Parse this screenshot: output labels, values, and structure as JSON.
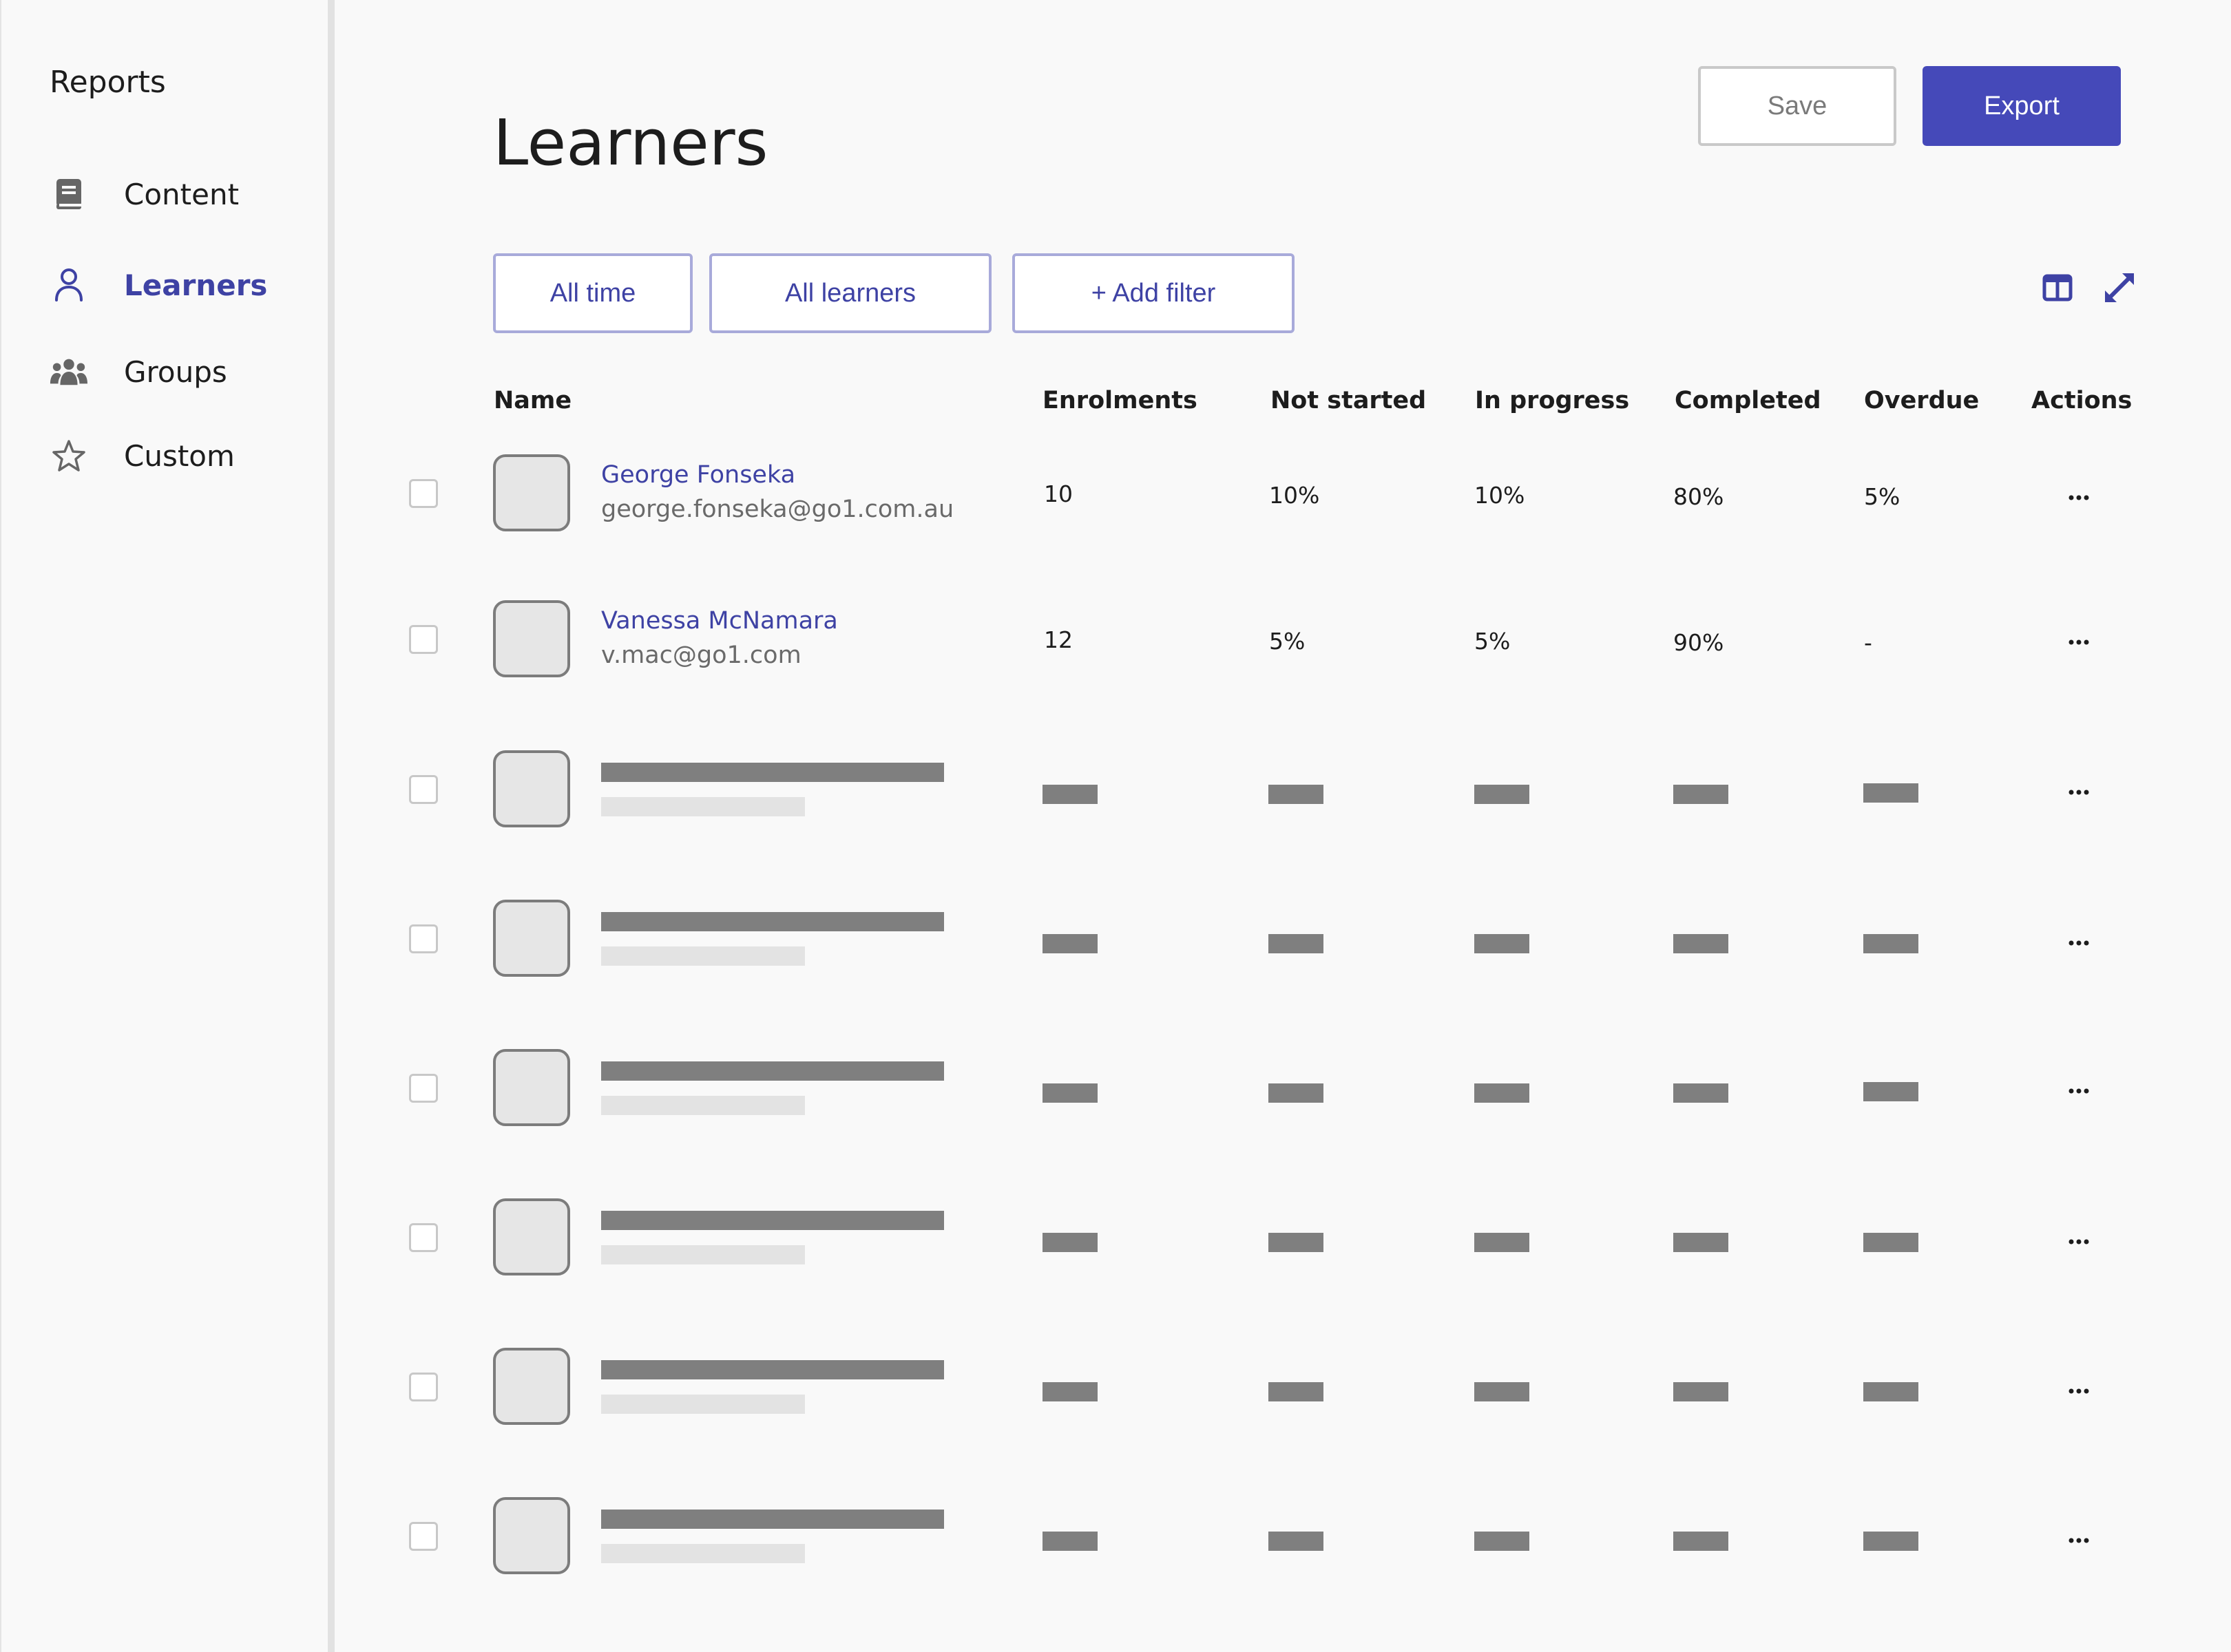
{
  "sidebar": {
    "title": "Reports",
    "items": [
      {
        "label": "Content",
        "icon": "book-icon",
        "active": false
      },
      {
        "label": "Learners",
        "icon": "person-icon",
        "active": true
      },
      {
        "label": "Groups",
        "icon": "group-icon",
        "active": false
      },
      {
        "label": "Custom",
        "icon": "star-icon",
        "active": false
      }
    ]
  },
  "header": {
    "title": "Learners",
    "save_label": "Save",
    "export_label": "Export"
  },
  "filters": {
    "time": "All time",
    "learners": "All learners",
    "add": "+ Add filter"
  },
  "toolbar": {
    "columns_icon": "columns-icon",
    "expand_icon": "expand-icon"
  },
  "table": {
    "columns": [
      "Name",
      "Enrolments",
      "Not started",
      "In progress",
      "Completed",
      "Overdue",
      "Actions"
    ],
    "rows": [
      {
        "name": "George Fonseka",
        "email": "george.fonseka@go1.com.au",
        "enrolments": "10",
        "not_started": "10%",
        "in_progress": "10%",
        "completed": "80%",
        "overdue": "5%"
      },
      {
        "name": "Vanessa McNamara",
        "email": "v.mac@go1.com",
        "enrolments": "12",
        "not_started": "5%",
        "in_progress": "5%",
        "completed": "90%",
        "overdue": "-"
      }
    ],
    "skeleton_row_count": 6
  },
  "colors": {
    "accent": "#4549b9",
    "link": "#3e42a4",
    "skeleton_dark": "#7f7f7f",
    "skeleton_light": "#e3e3e3"
  }
}
